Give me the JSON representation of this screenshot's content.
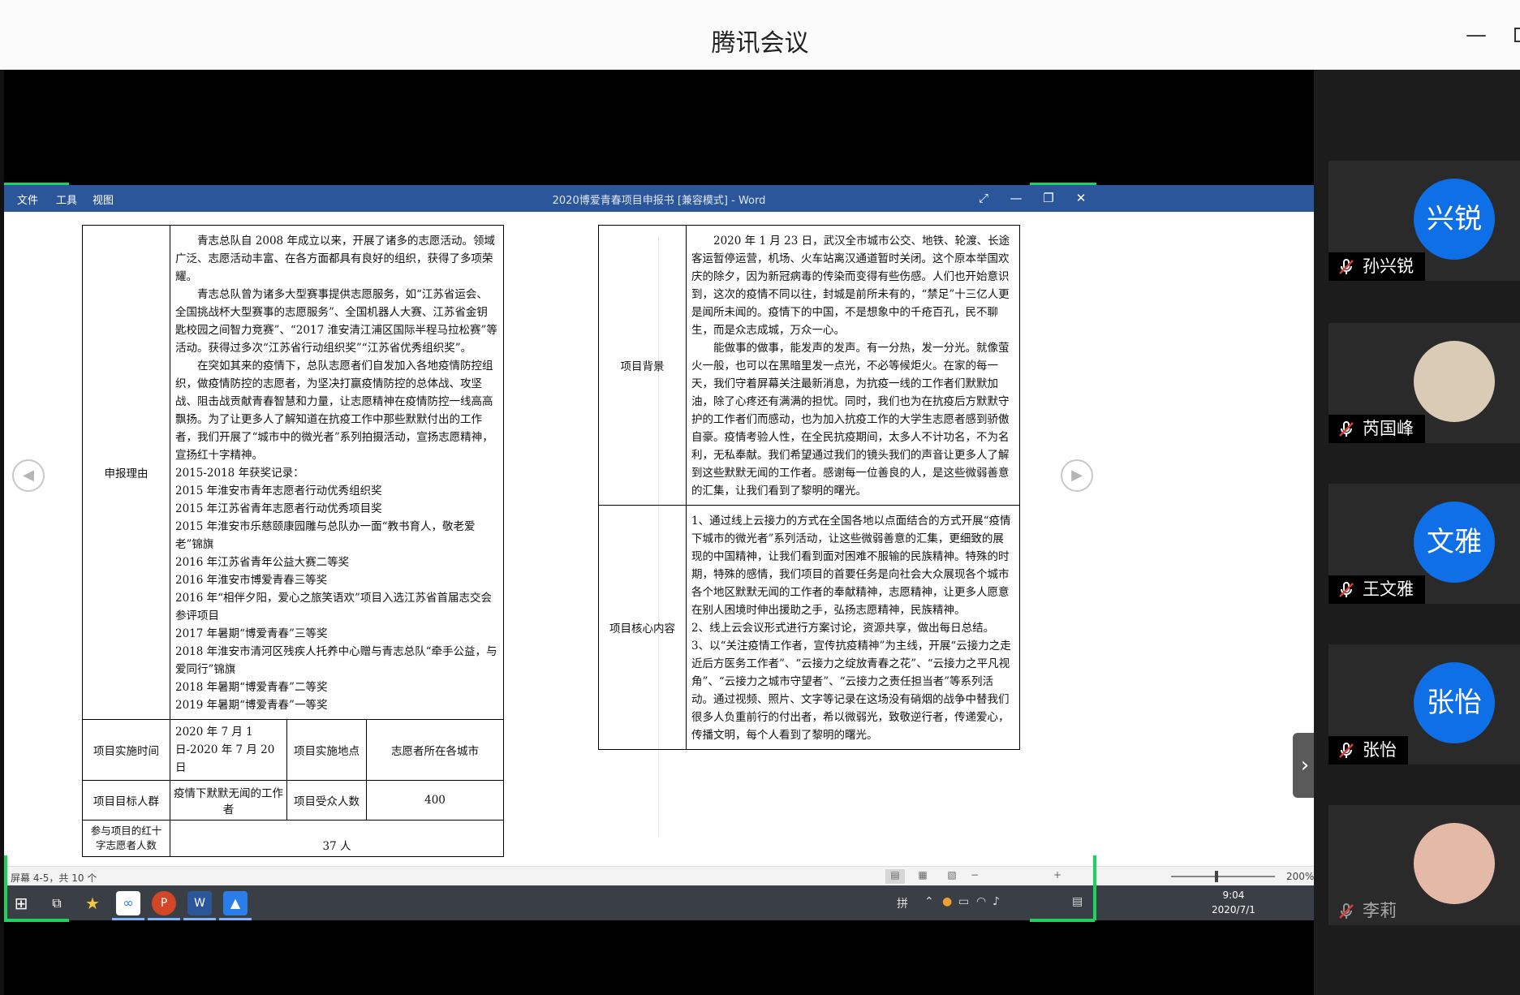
{
  "app": {
    "title": "腾讯会议"
  },
  "word": {
    "menu": [
      "文件",
      "工具",
      "视图"
    ],
    "doc_title": "2020博爱青春项目申报书 [兼容模式] - Word",
    "status_pages": "屏幕 4-5，共 10 个",
    "zoom": "200%"
  },
  "left_table": {
    "reason_label": "申报理由",
    "reason_paragraphs": [
      "青志总队自 2008 年成立以来，开展了诸多的志愿活动。领域广泛、志愿活动丰富、在各方面都具有良好的组织，获得了多项荣耀。",
      "青志总队曾为诸多大型赛事提供志愿服务，如“江苏省运会、全国挑战杯大型赛事的志愿服务”、全国机器人大赛、江苏省金钥匙校园之间智力竞赛”、“2017 淮安清江浦区国际半程马拉松赛”等活动。获得过多次“江苏省行动组织奖”“江苏省优秀组织奖”。",
      "在突如其来的疫情下，总队志愿者们自发加入各地疫情防控组织，做疫情防控的志愿者，为坚决打赢疫情防控的总体战、攻坚战、阻击战贡献青春智慧和力量，让志愿精神在疫情防控一线高高飘扬。为了让更多人了解知道在抗疫工作中那些默默付出的工作者，我们开展了“城市中的微光者”系列拍摄活动，宣扬志愿精神，宣扬红十字精神。"
    ],
    "awards_title": "2015-2018 年获奖记录：",
    "awards": [
      "2015 年淮安市青年志愿者行动优秀组织奖",
      "2015 年江苏省青年志愿者行动优秀项目奖",
      "2015 年淮安市乐慈颐康园雕与总队办一面“教书育人，敬老爱老”锦旗",
      "2016 年江苏省青年公益大赛二等奖",
      "2016 年淮安市博爱青春三等奖",
      "2016 年“相伴夕阳，爱心之旅笑语欢”项目入选江苏省首届志交会参评项目",
      "2017 年暑期“博爱青春”三等奖",
      "2018 年淮安市清河区残疾人托养中心赠与青志总队“牵手公益，与爱同行”锦旗",
      "2018 年暑期“博爱青春”二等奖",
      "2019 年暑期“博爱青春”一等奖"
    ],
    "time_label": "项目实施时间",
    "time_value": "2020 年 7 月 1 日-2020 年 7 月 20 日",
    "place_label": "项目实施地点",
    "place_value": "志愿者所在各城市",
    "target_label": "项目目标人群",
    "target_value": "疫情下默默无闻的工作者",
    "benef_label": "项目受众人数",
    "benef_value": "400",
    "volunteers_label": "参与项目的红十字志愿者人数",
    "volunteers_value": "37 人"
  },
  "right_table": {
    "background_label": "项目背景",
    "background_paragraphs": [
      "2020 年 1 月 23 日，武汉全市城市公交、地铁、轮渡、长途客运暂停运营，机场、火车站离汉通道暂时关闭。这个原本举国欢庆的除夕，因为新冠病毒的传染而变得有些伤感。人们也开始意识到，这次的疫情不同以往，封城是前所未有的，“禁足”十三亿人更是闻所未闻的。疫情下的中国，不是想象中的千疮百孔，民不聊生，而是众志成城，万众一心。",
      "能做事的做事，能发声的发声。有一分热，发一分光。就像萤火一般，也可以在黑暗里发一点光，不必等候炬火。在家的每一天，我们守着屏幕关注最新消息，为抗疫一线的工作者们默默加油，除了心疼还有满满的担忧。同时，我们也为在抗疫后方默默守护的工作者们而感动，也为加入抗疫工作的大学生志愿者感到骄傲自豪。疫情考验人性，在全民抗疫期间，太多人不计功名，不为名利，无私奉献。我们希望通过我们的镜头我们的声音让更多人了解到这些默默无闻的工作者。感谢每一位善良的人，是这些微弱善意的汇集，让我们看到了黎明的曙光。"
    ],
    "core_label": "项目核心内容",
    "core_paragraphs": [
      "1、通过线上云接力的方式在全国各地以点面结合的方式开展“疫情下城市的微光者”系列活动，让这些微弱善意的汇集，更细致的展现的中国精神，让我们看到面对困难不服输的民族精神。特殊的时期，特殊的感情，我们项目的首要任务是向社会大众展现各个城市各个地区默默无闻的工作者的奉献精神，志愿精神，让更多人愿意在别人困境时伸出援助之手，弘扬志愿精神，民族精神。",
      "2、线上云会议形式进行方案讨论，资源共享，做出每日总结。",
      "3、以“关注疫情工作者，宣传抗疫精神”为主线，开展“云接力之走近后方医务工作者”、“云接力之绽放青春之花”、“云接力之平凡视角”、“云接力之城市守望者”、“云接力之责任担当者”等系列活动。通过视频、照片、文字等记录在这场没有硝烟的战争中替我们很多人负重前行的付出者，希以微弱光，致敬逆行者，传递爱心，传播文明，每个人看到了黎明的曙光。"
    ]
  },
  "taskbar": {
    "ime": "拼",
    "time": "9:04",
    "date": "2020/7/1"
  },
  "participants": [
    {
      "name": "孙兴锐",
      "avatar_text": "兴锐",
      "avatar_color": "#0f6fe6"
    },
    {
      "name": "芮国峰",
      "avatar_text": "",
      "avatar_color": "#d9cbb6"
    },
    {
      "name": "王文雅",
      "avatar_text": "文雅",
      "avatar_color": "#0f6fe6"
    },
    {
      "name": "张怡",
      "avatar_text": "张怡",
      "avatar_color": "#0f6fe6"
    },
    {
      "name": "李莉",
      "avatar_text": "",
      "avatar_color": "#e4b9a8"
    }
  ],
  "colors": {
    "word_blue": "#2b579a",
    "share_green": "#1bd35e",
    "avatar_blue": "#0f6fe6",
    "muted_red": "#e23b3b"
  }
}
